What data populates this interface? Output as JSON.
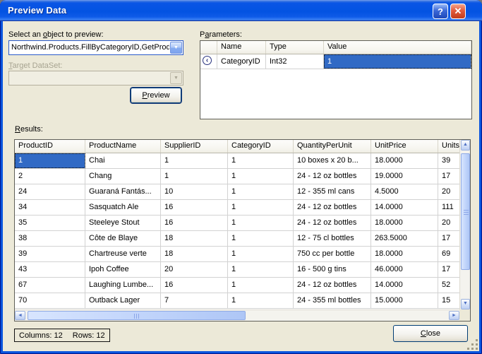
{
  "window": {
    "title": "Preview Data",
    "help_glyph": "?",
    "close_glyph": "✕"
  },
  "colors": {
    "titlebar_blue": "#0853E2",
    "dialog_bg": "#ECE9D8",
    "selection_blue": "#316AC5"
  },
  "icons": {
    "combo_chevron": "▼",
    "scroll_up": "▲",
    "scroll_down": "▼",
    "scroll_left": "◄",
    "scroll_right": "►",
    "param_direction": "‹"
  },
  "object_section": {
    "label": "Select an object to preview:",
    "combo_value": "Northwind.Products.FillByCategoryID,GetProd",
    "target_label": "Target DataSet:",
    "target_value": "",
    "preview_button": "Preview"
  },
  "parameters": {
    "label": "Parameters:",
    "columns": [
      "Name",
      "Type",
      "Value"
    ],
    "rows": [
      {
        "name": "CategoryID",
        "type": "Int32",
        "value": "1"
      }
    ]
  },
  "results": {
    "label": "Results:",
    "columns": [
      "ProductID",
      "ProductName",
      "SupplierID",
      "CategoryID",
      "QuantityPerUnit",
      "UnitPrice",
      "UnitsI"
    ],
    "selected": {
      "row": 0,
      "col": 0
    },
    "rows": [
      [
        "1",
        "Chai",
        "1",
        "1",
        "10 boxes x 20 b...",
        "18.0000",
        "39"
      ],
      [
        "2",
        "Chang",
        "1",
        "1",
        "24 - 12 oz bottles",
        "19.0000",
        "17"
      ],
      [
        "24",
        "Guaraná Fantás...",
        "10",
        "1",
        "12 - 355 ml cans",
        "4.5000",
        "20"
      ],
      [
        "34",
        "Sasquatch Ale",
        "16",
        "1",
        "24 - 12 oz bottles",
        "14.0000",
        "111"
      ],
      [
        "35",
        "Steeleye Stout",
        "16",
        "1",
        "24 - 12 oz bottles",
        "18.0000",
        "20"
      ],
      [
        "38",
        "Côte de Blaye",
        "18",
        "1",
        "12 - 75 cl bottles",
        "263.5000",
        "17"
      ],
      [
        "39",
        "Chartreuse verte",
        "18",
        "1",
        "750 cc per bottle",
        "18.0000",
        "69"
      ],
      [
        "43",
        "Ipoh Coffee",
        "20",
        "1",
        "16 - 500 g tins",
        "46.0000",
        "17"
      ],
      [
        "67",
        "Laughing Lumbe...",
        "16",
        "1",
        "24 - 12 oz bottles",
        "14.0000",
        "52"
      ],
      [
        "70",
        "Outback Lager",
        "7",
        "1",
        "24 - 355 ml bottles",
        "15.0000",
        "15"
      ]
    ]
  },
  "status": {
    "columns_text": "Columns: 12",
    "rows_text": "Rows: 12"
  },
  "buttons": {
    "close": "Close"
  }
}
